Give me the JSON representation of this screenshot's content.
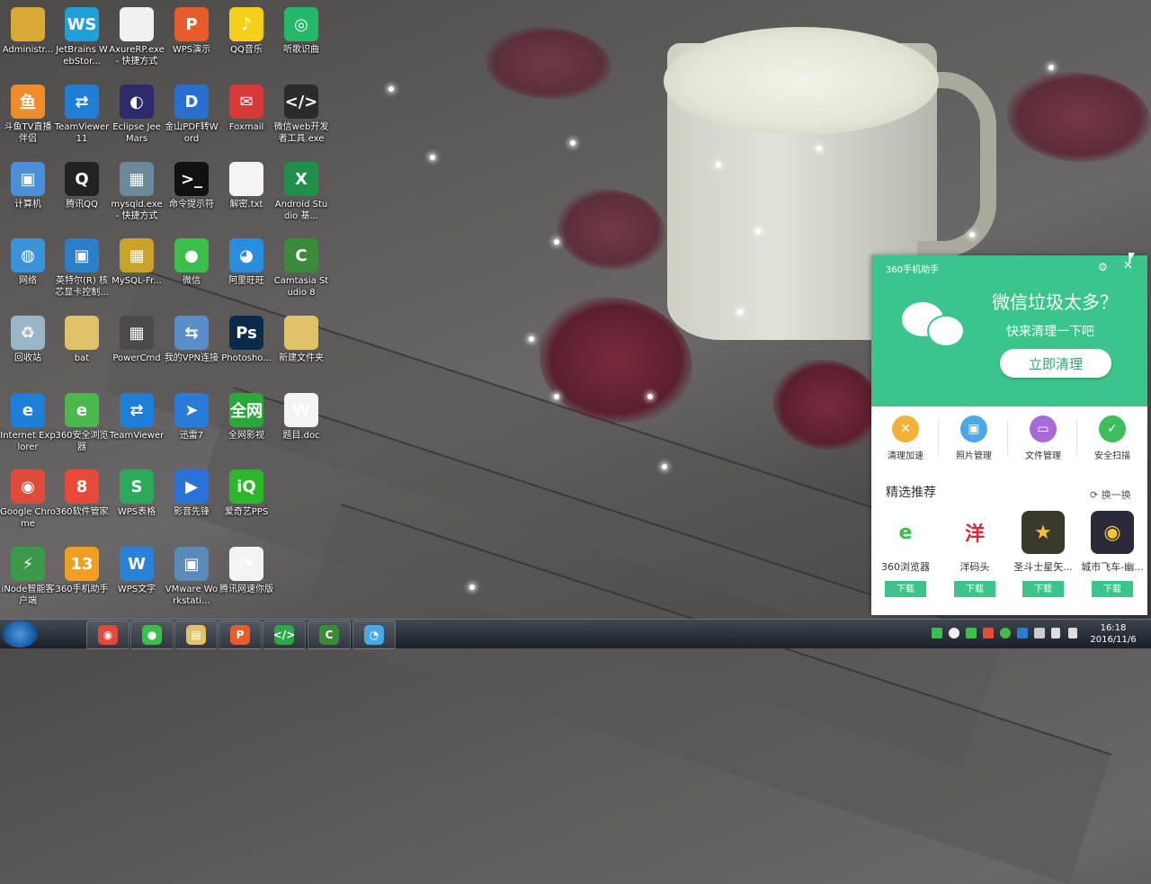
{
  "desktop": {
    "icons": [
      {
        "label": "Administr...",
        "icon": "user-folder-icon",
        "color": "#d8a936",
        "glyph": ""
      },
      {
        "label": "JetBrains WebStor...",
        "icon": "webstorm-icon",
        "color": "#1fa0d8",
        "glyph": "WS"
      },
      {
        "label": "AxureRP.exe - 快捷方式",
        "icon": "axure-icon",
        "color": "#f1f1f1",
        "glyph": ""
      },
      {
        "label": "WPS演示",
        "icon": "wps-presentation-icon",
        "color": "#e85c2c",
        "glyph": "P"
      },
      {
        "label": "QQ音乐",
        "icon": "qq-music-icon",
        "color": "#f5cf1a",
        "glyph": "♪"
      },
      {
        "label": "听歌识曲",
        "icon": "song-recognition-icon",
        "color": "#25b86a",
        "glyph": "◎"
      },
      {
        "label": "斗鱼TV直播伴侣",
        "icon": "douyu-icon",
        "color": "#f08c2c",
        "glyph": "鱼"
      },
      {
        "label": "TeamViewer 11",
        "icon": "teamviewer-icon",
        "color": "#1f7ed6",
        "glyph": "⇄"
      },
      {
        "label": "Eclipse Jee Mars",
        "icon": "eclipse-icon",
        "color": "#2c2a6a",
        "glyph": "◐"
      },
      {
        "label": "金山PDF转Word",
        "icon": "pdf-to-word-icon",
        "color": "#2a6fd0",
        "glyph": "D"
      },
      {
        "label": "Foxmail",
        "icon": "foxmail-icon",
        "color": "#d83838",
        "glyph": "✉"
      },
      {
        "label": "微信web开发者工具.exe",
        "icon": "wechat-devtools-icon",
        "color": "#2b2b2b",
        "glyph": "</>"
      },
      {
        "label": "计算机",
        "icon": "computer-icon",
        "color": "#4a8fd8",
        "glyph": "▣"
      },
      {
        "label": "腾讯QQ",
        "icon": "qq-icon",
        "color": "#222222",
        "glyph": "Q"
      },
      {
        "label": "mysqld.exe - 快捷方式",
        "icon": "mysqld-icon",
        "color": "#6a8a9a",
        "glyph": "▦"
      },
      {
        "label": "命令提示符",
        "icon": "cmd-icon",
        "color": "#111111",
        "glyph": ">_"
      },
      {
        "label": "解密.txt",
        "icon": "text-file-icon",
        "color": "#f4f4f4",
        "glyph": ""
      },
      {
        "label": "Android Studio 基...",
        "icon": "excel-file-icon",
        "color": "#1f8f4a",
        "glyph": "X"
      },
      {
        "label": "网络",
        "icon": "network-icon",
        "color": "#3a92d8",
        "glyph": "◍"
      },
      {
        "label": "英特尔(R) 核芯显卡控制...",
        "icon": "intel-graphics-icon",
        "color": "#2b7fc8",
        "glyph": "▣"
      },
      {
        "label": "MySQL-Fr...",
        "icon": "mysql-front-icon",
        "color": "#c8a22a",
        "glyph": "▦"
      },
      {
        "label": "微信",
        "icon": "wechat-icon",
        "color": "#3cbf4a",
        "glyph": "●"
      },
      {
        "label": "阿里旺旺",
        "icon": "aliwangwang-icon",
        "color": "#2a8ee0",
        "glyph": "◕"
      },
      {
        "label": "Camtasia Studio 8",
        "icon": "camtasia-icon",
        "color": "#3a8a3a",
        "glyph": "C"
      },
      {
        "label": "回收站",
        "icon": "recycle-bin-icon",
        "color": "#9ab4c8",
        "glyph": "♻"
      },
      {
        "label": "bat",
        "icon": "folder-icon",
        "color": "#e0c26a",
        "glyph": ""
      },
      {
        "label": "PowerCmd",
        "icon": "powercmd-icon",
        "color": "#4a4a4a",
        "glyph": "▦"
      },
      {
        "label": "我的VPN连接",
        "icon": "vpn-icon",
        "color": "#5a8ec8",
        "glyph": "⇆"
      },
      {
        "label": "Photosho...",
        "icon": "photoshop-icon",
        "color": "#0a2a4a",
        "glyph": "Ps"
      },
      {
        "label": "新建文件夹",
        "icon": "folder-icon",
        "color": "#e0c26a",
        "glyph": ""
      },
      {
        "label": "Internet Explorer",
        "icon": "internet-explorer-icon",
        "color": "#1e7fd8",
        "glyph": "e"
      },
      {
        "label": "360安全浏览器",
        "icon": "360-browser-icon",
        "color": "#4ab84a",
        "glyph": "e"
      },
      {
        "label": "TeamViewer",
        "icon": "teamviewer-icon",
        "color": "#1f7ed6",
        "glyph": "⇄"
      },
      {
        "label": "迅雷7",
        "icon": "xunlei-icon",
        "color": "#2a7ad8",
        "glyph": "➤"
      },
      {
        "label": "全网影视",
        "icon": "video-app-icon",
        "color": "#2aa83a",
        "glyph": "全网"
      },
      {
        "label": "题目.doc",
        "icon": "word-doc-icon",
        "color": "#f4f4f4",
        "glyph": "W"
      },
      {
        "label": "Google Chrome",
        "icon": "chrome-icon",
        "color": "#e04a3a",
        "glyph": "◉"
      },
      {
        "label": "360软件管家",
        "icon": "360-software-icon",
        "color": "#e84a3a",
        "glyph": "8"
      },
      {
        "label": "WPS表格",
        "icon": "wps-spreadsheet-icon",
        "color": "#2aaa5a",
        "glyph": "S"
      },
      {
        "label": "影音先锋",
        "icon": "media-player-icon",
        "color": "#2a72d8",
        "glyph": "▶"
      },
      {
        "label": "爱奇艺PPS",
        "icon": "iqiyi-icon",
        "color": "#2ab82a",
        "glyph": "iQ"
      },
      {
        "label": "iNode智能客户端",
        "icon": "inode-icon",
        "color": "#3a9a4a",
        "glyph": "⚡"
      },
      {
        "label": "360手机助手",
        "icon": "360-mobile-icon",
        "color": "#f0a020",
        "glyph": "13"
      },
      {
        "label": "WPS文字",
        "icon": "wps-writer-icon",
        "color": "#2a82d8",
        "glyph": "W"
      },
      {
        "label": "VMware Workstati...",
        "icon": "vmware-icon",
        "color": "#5a8ab8",
        "glyph": "▣"
      },
      {
        "label": "腾讯网速你版",
        "icon": "tencent-speed-icon",
        "color": "#f4f4f4",
        "glyph": "◔"
      }
    ]
  },
  "popup": {
    "app_title": "360手机助手",
    "headline": "微信垃圾太多？",
    "subline": "快来清理一下吧",
    "clean_button": "立即清理",
    "tools": [
      {
        "label": "清理加速",
        "icon": "speed-up-icon",
        "color": "#f2b23a",
        "glyph": "✕"
      },
      {
        "label": "照片管理",
        "icon": "photo-manage-icon",
        "color": "#4aa8e8",
        "glyph": "▣"
      },
      {
        "label": "文件管理",
        "icon": "file-manage-icon",
        "color": "#a86ad8",
        "glyph": "▭"
      },
      {
        "label": "安全扫描",
        "icon": "security-scan-icon",
        "color": "#3cbf5a",
        "glyph": "✓"
      }
    ],
    "recommend_title": "精选推荐",
    "refresh_label": "换一换",
    "apps": [
      {
        "name": "360浏览器",
        "icon": "360-browser-app-icon",
        "color": "#ffffff",
        "glyph": "e",
        "download": "下载"
      },
      {
        "name": "洋码头",
        "icon": "yangmatou-icon",
        "color": "#ffffff",
        "glyph": "洋",
        "download": "下载"
      },
      {
        "name": "圣斗士星矢...",
        "icon": "saint-seiya-icon",
        "color": "#3a3a2a",
        "glyph": "★",
        "download": "下载"
      },
      {
        "name": "城市飞车-幽...",
        "icon": "city-racing-icon",
        "color": "#2a2a3a",
        "glyph": "◉",
        "download": "下载"
      }
    ]
  },
  "taskbar": {
    "apps": [
      {
        "name": "chrome",
        "icon": "chrome-icon",
        "color": "#e04a3a",
        "glyph": "◉"
      },
      {
        "name": "wechat",
        "icon": "wechat-icon",
        "color": "#3cbf4a",
        "glyph": "●"
      },
      {
        "name": "explorer",
        "icon": "file-explorer-icon",
        "color": "#e0c26a",
        "glyph": "▤"
      },
      {
        "name": "wps-presentation",
        "icon": "wps-presentation-icon",
        "color": "#e85c2c",
        "glyph": "P"
      },
      {
        "name": "wechat-devtools",
        "icon": "wechat-devtools-icon",
        "color": "#2aa84a",
        "glyph": "</>"
      },
      {
        "name": "camtasia",
        "icon": "camtasia-icon",
        "color": "#3a8a3a",
        "glyph": "C"
      },
      {
        "name": "tencent-speed",
        "icon": "tencent-speed-icon",
        "color": "#4aa8e8",
        "glyph": "◔"
      }
    ],
    "clock_time": "16:18",
    "clock_date": "2016/11/6"
  },
  "colors": {
    "accent": "#3cc58a"
  }
}
